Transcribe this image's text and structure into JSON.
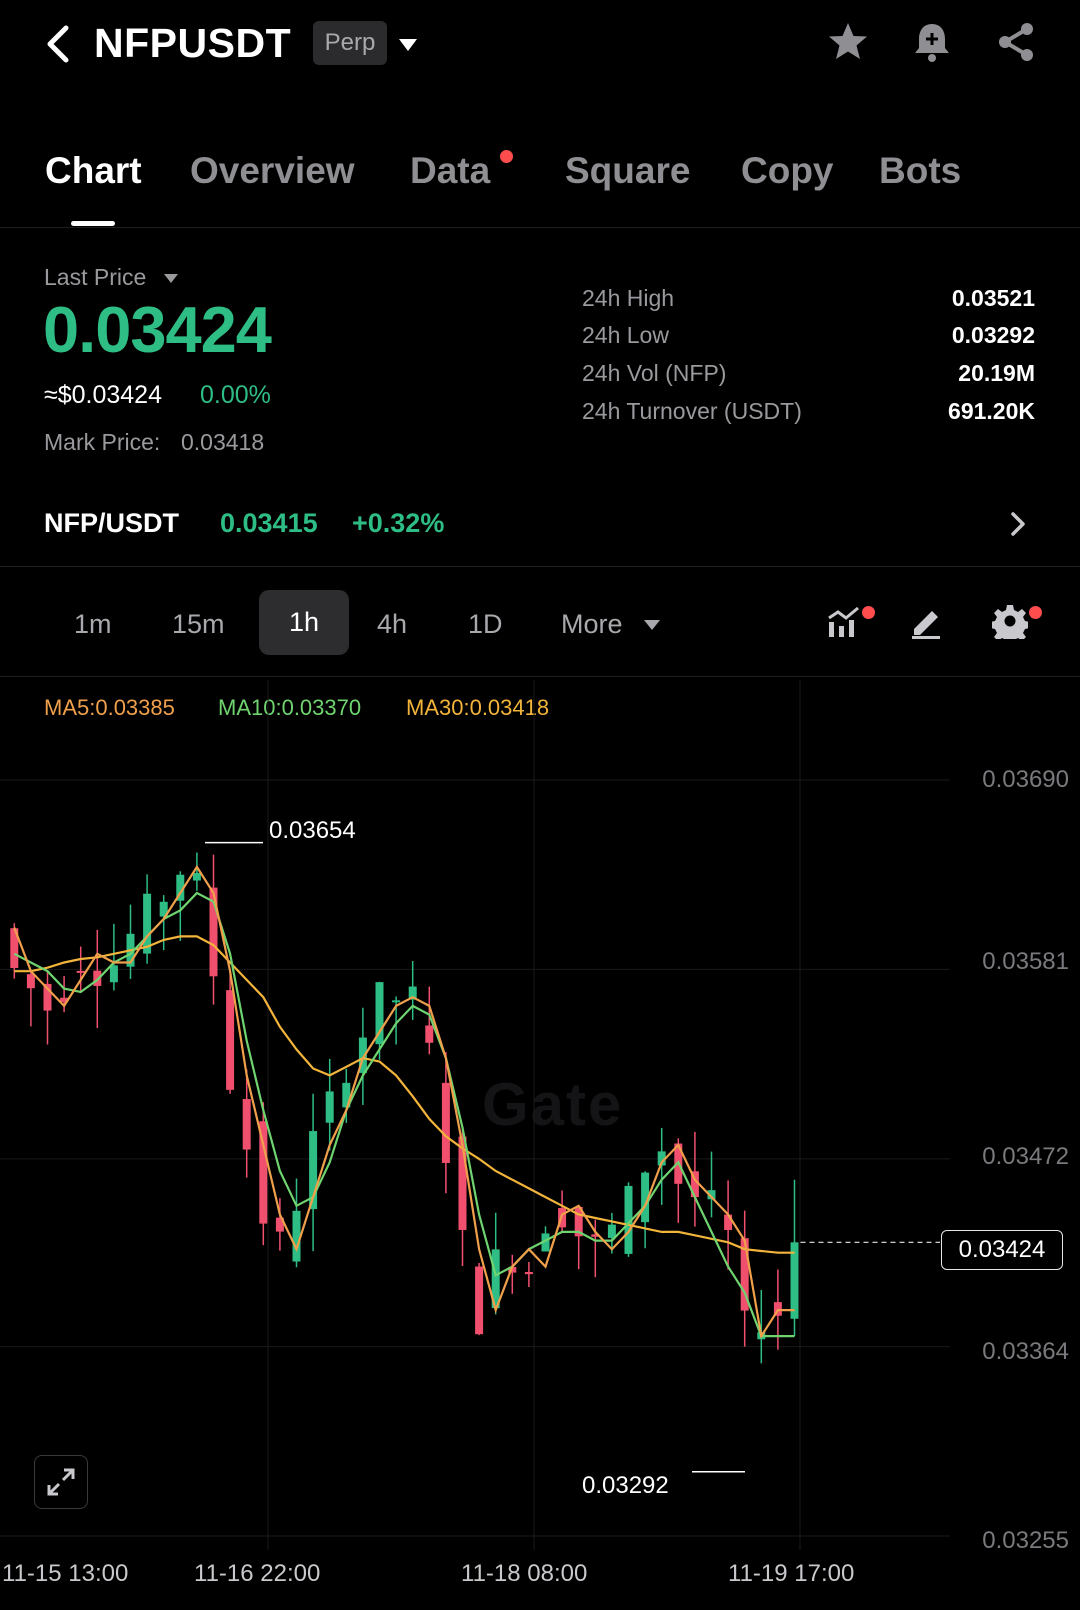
{
  "header": {
    "symbol": "NFPUSDT",
    "contract_type": "Perp"
  },
  "tabs": [
    {
      "label": "Chart",
      "active": true
    },
    {
      "label": "Overview",
      "active": false
    },
    {
      "label": "Data",
      "active": false,
      "has_dot": true
    },
    {
      "label": "Square",
      "active": false
    },
    {
      "label": "Copy",
      "active": false
    },
    {
      "label": "Bots",
      "active": false
    }
  ],
  "price": {
    "last_price_label": "Last Price",
    "last_price": "0.03424",
    "usd_price": "≈$0.03424",
    "change_pct": "0.00%",
    "mark_price_label": "Mark Price:",
    "mark_price": "0.03418"
  },
  "stats": [
    {
      "label": "24h High",
      "value": "0.03521"
    },
    {
      "label": "24h Low",
      "value": "0.03292"
    },
    {
      "label": "24h Vol (NFP)",
      "value": "20.19M"
    },
    {
      "label": "24h Turnover (USDT)",
      "value": "691.20K"
    }
  ],
  "spot": {
    "pair": "NFP/USDT",
    "price": "0.03415",
    "change": "+0.32%"
  },
  "intervals": [
    {
      "label": "1m",
      "active": false
    },
    {
      "label": "15m",
      "active": false
    },
    {
      "label": "1h",
      "active": true
    },
    {
      "label": "4h",
      "active": false
    },
    {
      "label": "1D",
      "active": false
    },
    {
      "label": "More",
      "active": false
    }
  ],
  "ma": {
    "ma5": "MA5:0.03385",
    "ma10": "MA10:0.03370",
    "ma30": "MA30:0.03418"
  },
  "colors": {
    "up": "#2ebd85",
    "down": "#f0506e",
    "ma5": "#f0a04b",
    "ma10": "#6fd46f",
    "ma30": "#f2b43a",
    "accent_dot": "#ff4d4d"
  },
  "chart": {
    "watermark": "Gate",
    "high_marker": "0.03654",
    "low_marker": "0.03292",
    "current_price_tag": "0.03424",
    "y_ticks": [
      "0.03690",
      "0.03581",
      "0.03472",
      "0.03364",
      "0.03255"
    ],
    "x_ticks": [
      "11-15 13:00",
      "11-16 22:00",
      "11-18 08:00",
      "11-19 17:00"
    ]
  },
  "chart_data": {
    "type": "candlestick",
    "interval": "1h",
    "ylim": [
      0.03255,
      0.0369
    ],
    "y_ticks": [
      0.0369,
      0.03581,
      0.03472,
      0.03364,
      0.03255
    ],
    "x_ticks": [
      "11-15 13:00",
      "11-16 22:00",
      "11-18 08:00",
      "11-19 17:00"
    ],
    "period_high": 0.03654,
    "period_low": 0.03292,
    "last_close": 0.03424,
    "series": [
      {
        "name": "MA5",
        "last": 0.03385
      },
      {
        "name": "MA10",
        "last": 0.0337
      },
      {
        "name": "MA30",
        "last": 0.03418
      }
    ],
    "ma5": [
      0.03605,
      0.0358,
      0.0357,
      0.0356,
      0.03575,
      0.0359,
      0.03585,
      0.03585,
      0.036,
      0.0361,
      0.03625,
      0.0364,
      0.03625,
      0.0358,
      0.0352,
      0.0348,
      0.0344,
      0.0342,
      0.0345,
      0.0348,
      0.035,
      0.0353,
      0.03545,
      0.0356,
      0.03565,
      0.0356,
      0.0353,
      0.0348,
      0.0342,
      0.03385,
      0.0341,
      0.0342,
      0.0341,
      0.0344,
      0.03445,
      0.0343,
      0.0342,
      0.0343,
      0.03445,
      0.0347,
      0.0348,
      0.0346,
      0.0345,
      0.0344,
      0.03425,
      0.0337,
      0.03385,
      0.03385
    ],
    "ma10": [
      0.0359,
      0.03585,
      0.0358,
      0.0357,
      0.03568,
      0.03575,
      0.03585,
      0.0359,
      0.036,
      0.0361,
      0.03615,
      0.03625,
      0.0362,
      0.0359,
      0.0354,
      0.035,
      0.03465,
      0.03445,
      0.0345,
      0.0347,
      0.035,
      0.0352,
      0.03535,
      0.0355,
      0.0356,
      0.03555,
      0.0353,
      0.0349,
      0.0344,
      0.03405,
      0.0341,
      0.0342,
      0.03425,
      0.0343,
      0.0343,
      0.03425,
      0.03425,
      0.03435,
      0.03445,
      0.0346,
      0.0347,
      0.0345,
      0.0343,
      0.0341,
      0.03395,
      0.0337,
      0.0337,
      0.0337
    ],
    "ma30": [
      0.0358,
      0.0358,
      0.03582,
      0.03585,
      0.03587,
      0.03588,
      0.0359,
      0.03592,
      0.03594,
      0.03598,
      0.036,
      0.036,
      0.03595,
      0.03585,
      0.03575,
      0.03565,
      0.03548,
      0.03535,
      0.03524,
      0.0352,
      0.03525,
      0.0353,
      0.03528,
      0.0352,
      0.03508,
      0.03495,
      0.03485,
      0.03478,
      0.03472,
      0.03465,
      0.0346,
      0.03455,
      0.0345,
      0.03445,
      0.0344,
      0.03438,
      0.03436,
      0.03434,
      0.03432,
      0.0343,
      0.0343,
      0.03428,
      0.03426,
      0.03424,
      0.0342,
      0.03419,
      0.03418,
      0.03418
    ]
  }
}
